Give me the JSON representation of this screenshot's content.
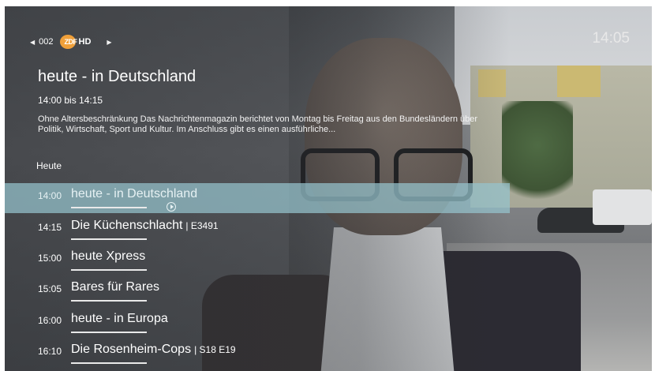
{
  "header": {
    "channel_number": "002",
    "channel_logo_text": "ZDF",
    "channel_logo_hd": "HD",
    "clock": "14:05"
  },
  "program": {
    "title": "heute - in Deutschland",
    "time_range": "14:00 bis 14:15",
    "description": "Ohne Altersbeschränkung Das Nachrichtenmagazin berichtet von Montag bis Freitag aus den Bundesländern über Politik, Wirtschaft, Sport und Kultur. Im Anschluss gibt es einen ausführliche..."
  },
  "schedule": {
    "day_label": "Heute",
    "items": [
      {
        "time": "14:00",
        "title": "heute - in Deutschland",
        "episode": "",
        "selected": true
      },
      {
        "time": "14:15",
        "title": "Die Küchenschlacht",
        "episode": "| E3491",
        "selected": false
      },
      {
        "time": "15:00",
        "title": "heute Xpress",
        "episode": "",
        "selected": false
      },
      {
        "time": "15:05",
        "title": "Bares für Rares",
        "episode": "",
        "selected": false
      },
      {
        "time": "16:00",
        "title": "heute - in Europa",
        "episode": "",
        "selected": false
      },
      {
        "time": "16:10",
        "title": "Die Rosenheim-Cops",
        "episode": "| S18 E19",
        "selected": false
      }
    ]
  },
  "colors": {
    "selected_row": "#96c3cd",
    "logo": "#f0a03a"
  },
  "icons": {
    "prev_channel": "chevron-left-icon",
    "next_channel": "chevron-right-icon",
    "play": "play-circle-icon"
  }
}
